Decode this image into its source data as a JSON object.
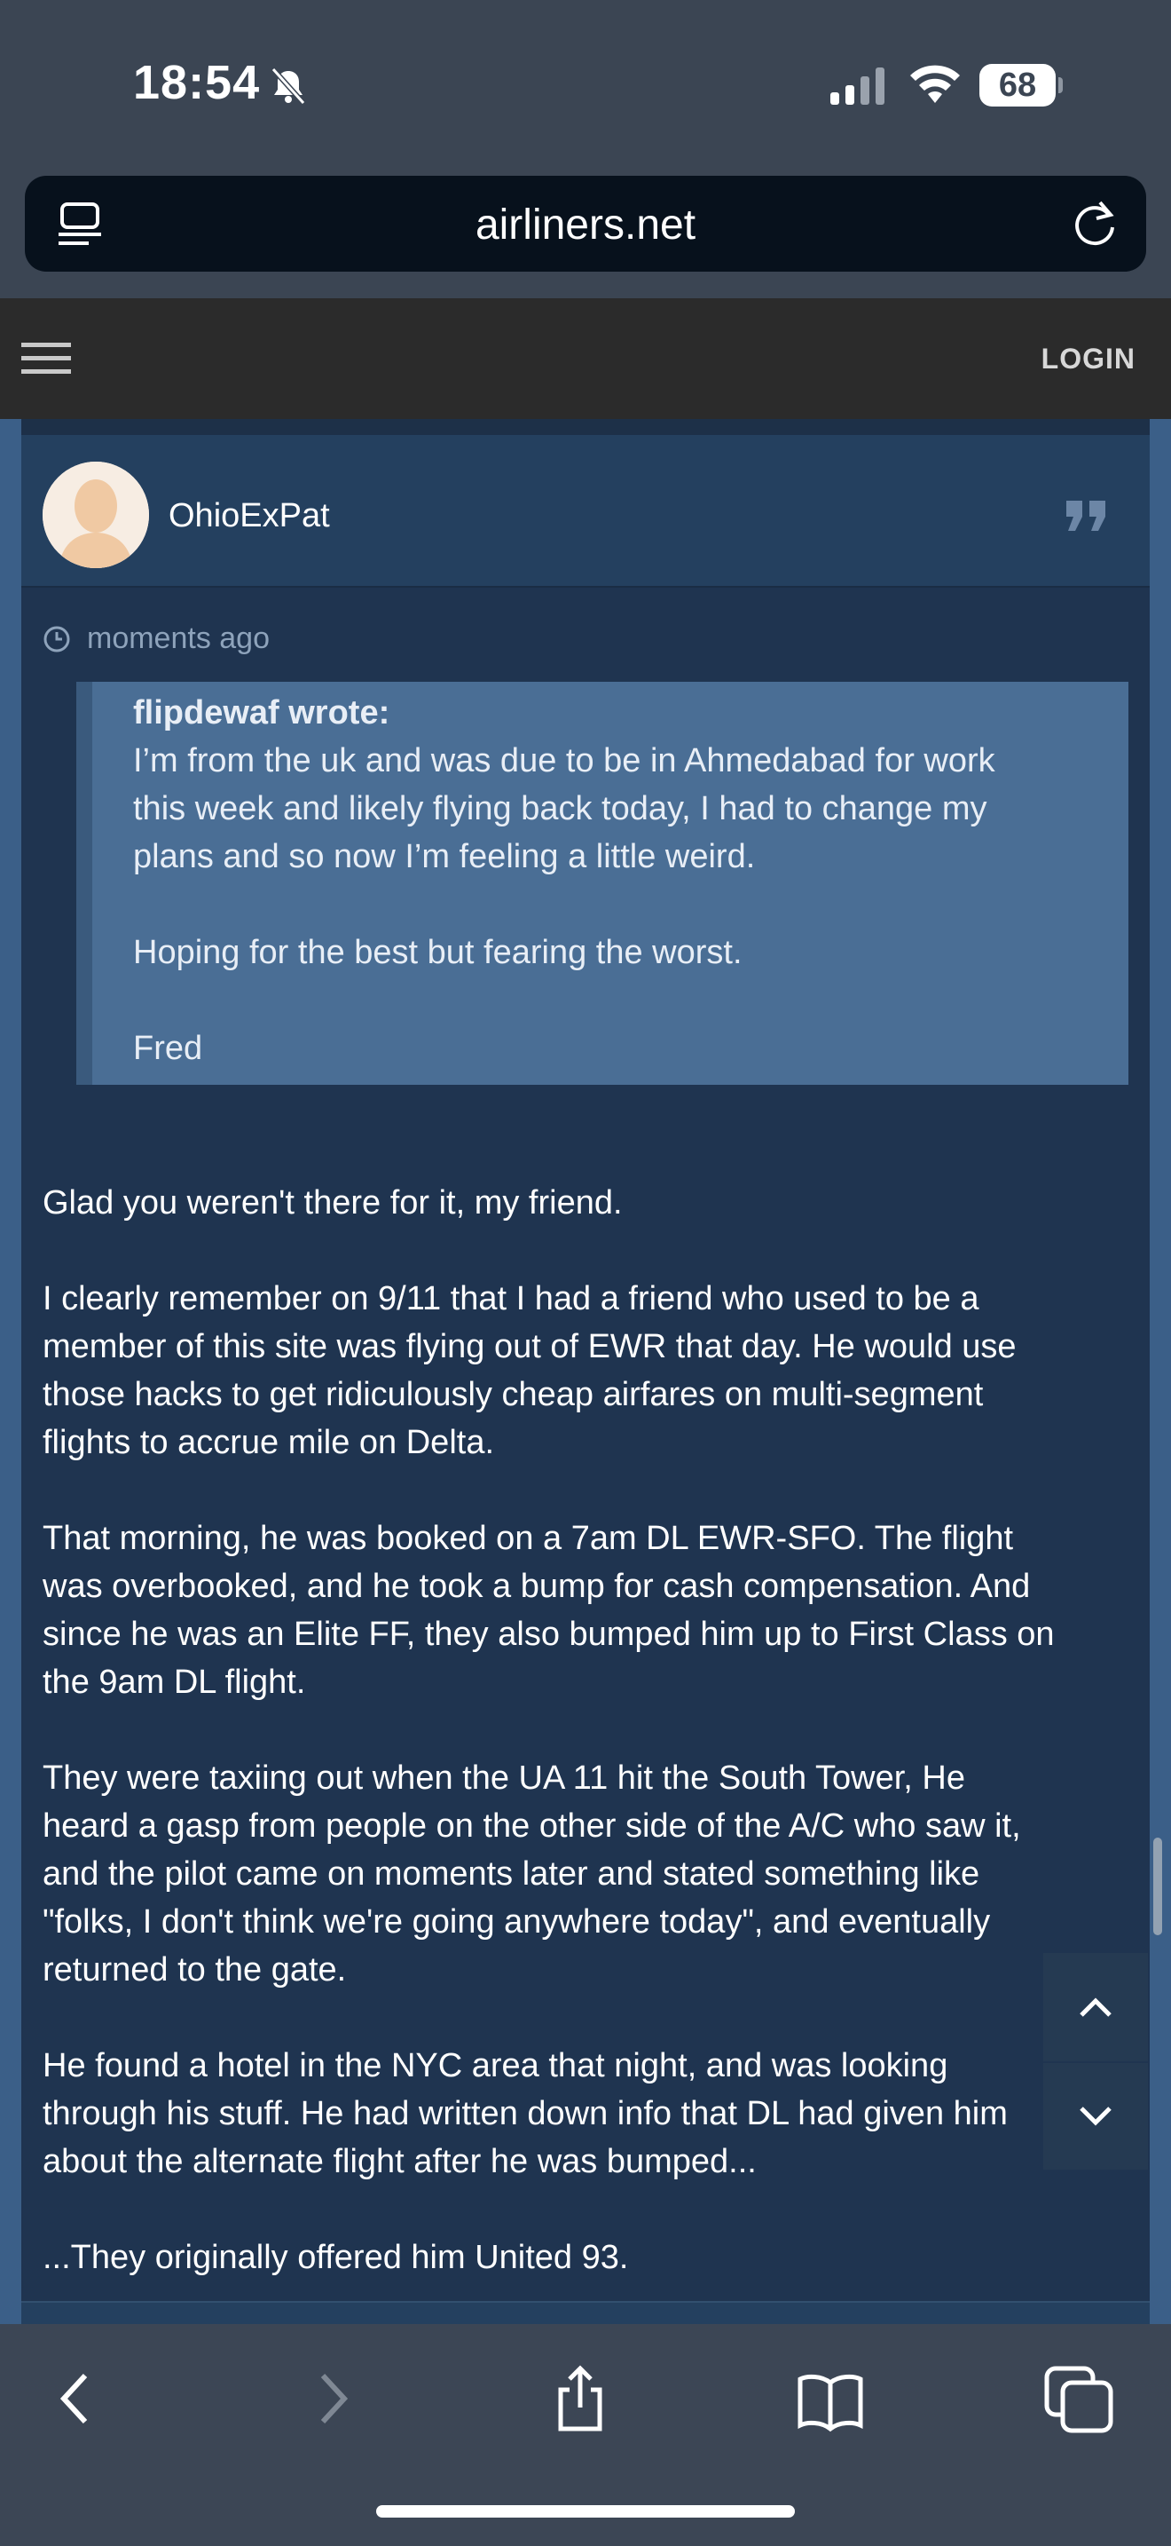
{
  "status_bar": {
    "time": "18:54",
    "battery": "68"
  },
  "browser": {
    "url": "airliners.net"
  },
  "site_header": {
    "login_label": "LOGIN"
  },
  "post": {
    "username": "OhioExPat",
    "timestamp": "moments ago",
    "quote": {
      "author": "flipdewaf wrote:",
      "lines": [
        "I’m from the uk and was due to be in Ahmedabad for work",
        "this week and likely flying back today, I had to change my",
        "plans and so now I’m feeling a little weird.",
        "",
        "Hoping for the best but fearing the worst.",
        "",
        "Fred"
      ]
    },
    "body_lines": [
      "Glad you weren't there for it, my friend.",
      "",
      "I clearly remember on 9/11 that I had a friend who used to be a",
      "member of this site was flying out of EWR that day. He would use",
      "those hacks to get ridiculously cheap airfares on multi-segment",
      "flights to accrue mile on Delta.",
      "",
      "That morning, he was booked on a 7am DL EWR-SFO. The flight",
      "was overbooked, and he took a bump for cash compensation. And",
      "since he was an Elite FF, they also bumped him up to First Class on",
      "the 9am DL flight.",
      "",
      "They were taxiing out when the UA 11 hit the South Tower, He",
      "heard a gasp from people on the other side of the A/C who saw it,",
      "and the pilot came on moments later and stated something like",
      "\"folks, I don't think we're going anywhere today\", and eventually",
      "returned to the gate.",
      "",
      "He found a hotel in the NYC area that night, and was looking",
      "through his stuff. He had written down info that DL had given him",
      "about the alternate flight after he was bumped...",
      "",
      "...They originally offered him United 93."
    ]
  },
  "icons": {
    "status": [
      "bell-slash-icon",
      "cellular-signal-icon",
      "wifi-icon",
      "battery-icon"
    ],
    "browser": [
      "reader-mode-icon",
      "reload-icon"
    ],
    "header": [
      "hamburger-menu-icon"
    ],
    "post": [
      "avatar",
      "quote-icon",
      "clock-icon"
    ],
    "navigation": [
      "chevron-up-icon",
      "chevron-down-icon"
    ],
    "toolbar": [
      "back-icon",
      "forward-icon",
      "share-icon",
      "bookmarks-icon",
      "tabs-icon"
    ]
  },
  "colors": {
    "page_bg": "#1f3450",
    "post_header_bg": "#24405f",
    "quote_bg": "#4a6e95",
    "site_header_bg": "#2b2b2b",
    "chrome_bg": "#3b4553",
    "url_bar_bg": "#07111c"
  }
}
